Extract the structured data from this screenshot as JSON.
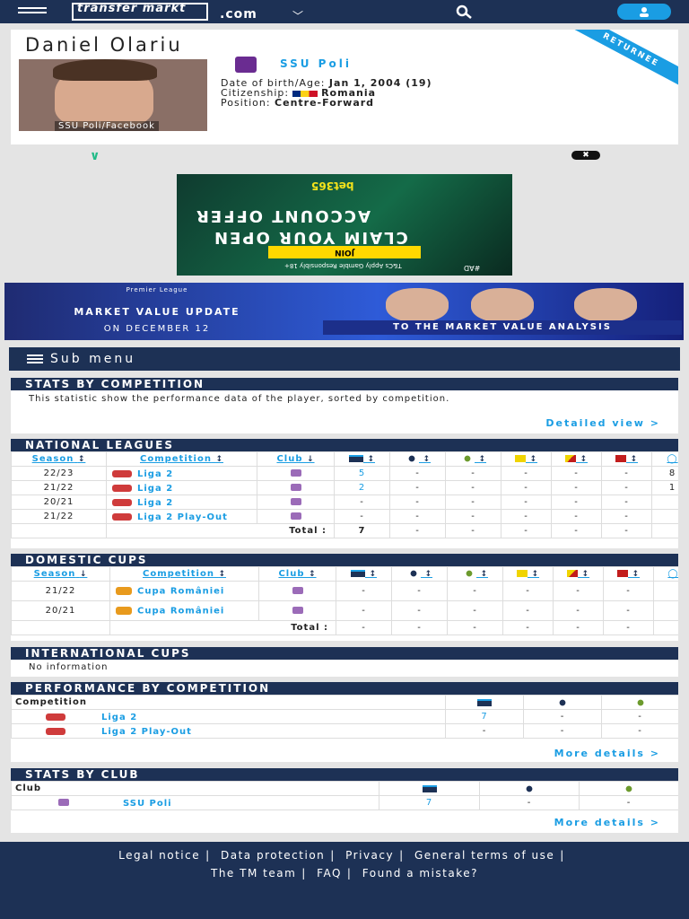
{
  "header": {
    "logo_text": "transfer markt",
    "domain": ".com"
  },
  "player": {
    "name": "Daniel Olariu",
    "badge": "RETURNEE",
    "photo_caption": "SSU Poli/Facebook",
    "club": "SSU Poli",
    "dob_label": "Date of birth/Age:",
    "dob_value": "Jan 1, 2004 (19)",
    "citizenship_label": "Citizenship:",
    "citizenship_value": "Romania",
    "position_label": "Position:",
    "position_value": "Centre-Forward"
  },
  "ads": {
    "bet365": {
      "brand": "bet365",
      "line1": "CLAIM YOUR OPEN",
      "line2": "ACCOUNT OFFER",
      "join": "JOIN",
      "terms": "T&Cs Apply  Gamble Responsibly  18+",
      "label": "#AD"
    },
    "premier": {
      "league": "Premier League",
      "title": "MARKET VALUE UPDATE",
      "date": "ON DECEMBER 12",
      "cta": "TO THE MARKET VALUE ANALYSIS"
    }
  },
  "submenu": {
    "label": "Sub menu"
  },
  "stats": {
    "title": "STATS BY COMPETITION",
    "desc": "This statistic show the performance data of the player, sorted by competition.",
    "link": "Detailed view  >"
  },
  "national": {
    "title": "NATIONAL LEAGUES",
    "headers": {
      "season": "Season",
      "competition": "Competition",
      "club": "Club"
    },
    "rows": [
      {
        "season": "22/23",
        "comp": "Liga 2",
        "apps": "5",
        "goals": "-",
        "assists": "-",
        "yellow": "-",
        "yr": "-",
        "red": "-",
        "min": "8"
      },
      {
        "season": "21/22",
        "comp": "Liga 2",
        "apps": "2",
        "goals": "-",
        "assists": "-",
        "yellow": "-",
        "yr": "-",
        "red": "-",
        "min": "1"
      },
      {
        "season": "20/21",
        "comp": "Liga 2",
        "apps": "-",
        "goals": "-",
        "assists": "-",
        "yellow": "-",
        "yr": "-",
        "red": "-",
        "min": ""
      },
      {
        "season": "21/22",
        "comp": "Liga 2 Play-Out",
        "apps": "-",
        "goals": "-",
        "assists": "-",
        "yellow": "-",
        "yr": "-",
        "red": "-",
        "min": ""
      }
    ],
    "total": {
      "label": "Total :",
      "apps": "7",
      "goals": "-",
      "assists": "-",
      "yellow": "-",
      "yr": "-",
      "red": "-"
    }
  },
  "domestic": {
    "title": "DOMESTIC CUPS",
    "headers": {
      "season": "Season",
      "competition": "Competition",
      "club": "Club"
    },
    "rows": [
      {
        "season": "21/22",
        "comp": "Cupa României",
        "apps": "-",
        "goals": "-",
        "assists": "-",
        "yellow": "-",
        "yr": "-",
        "red": "-"
      },
      {
        "season": "20/21",
        "comp": "Cupa României",
        "apps": "-",
        "goals": "-",
        "assists": "-",
        "yellow": "-",
        "yr": "-",
        "red": "-"
      }
    ],
    "total": {
      "label": "Total :",
      "apps": "-",
      "goals": "-",
      "assists": "-",
      "yellow": "-",
      "yr": "-",
      "red": "-"
    }
  },
  "international": {
    "title": "INTERNATIONAL CUPS",
    "text": "No information"
  },
  "performance": {
    "title": "PERFORMANCE BY COMPETITION",
    "header": "Competition",
    "rows": [
      {
        "comp": "Liga 2",
        "apps": "7",
        "goals": "-",
        "assists": "-"
      },
      {
        "comp": "Liga 2 Play-Out",
        "apps": "-",
        "goals": "-",
        "assists": "-"
      }
    ],
    "link": "More details  >"
  },
  "byclub": {
    "title": "STATS BY CLUB",
    "header": "Club",
    "rows": [
      {
        "club": "SSU Poli",
        "apps": "7",
        "goals": "-",
        "assists": "-"
      }
    ],
    "link": "More details  >"
  },
  "footer": {
    "links": [
      "Legal notice",
      "Data protection",
      "Privacy",
      "General terms of use",
      "The TM team",
      "FAQ",
      "Found a mistake?"
    ]
  },
  "colors": {
    "navy": "#1d3155",
    "accent": "#1a9de3"
  }
}
